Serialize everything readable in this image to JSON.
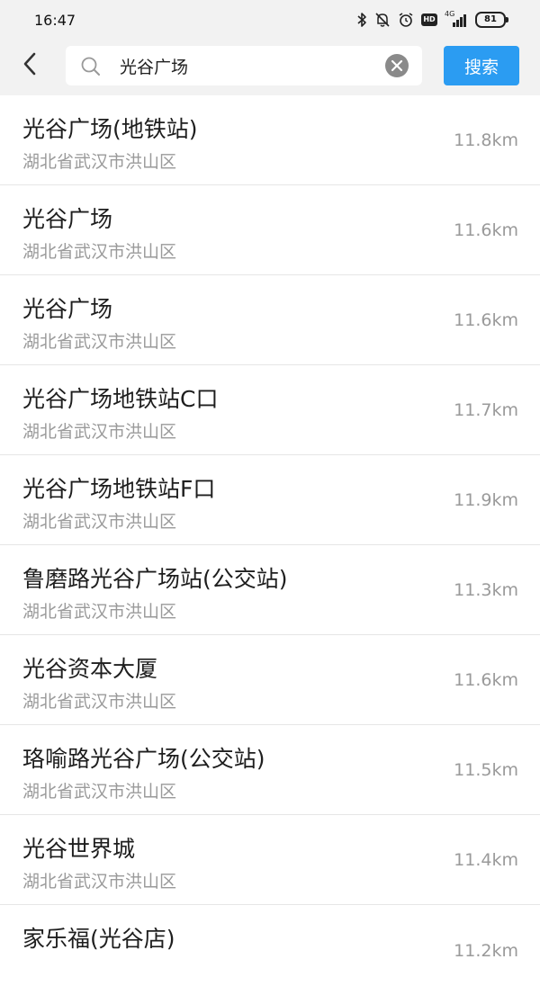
{
  "status_bar": {
    "time": "16:47",
    "network_label": "4G",
    "battery_level": "81",
    "hd_label": "HD",
    "icons": [
      "bluetooth-icon",
      "mute-icon",
      "alarm-icon",
      "hd-icon",
      "signal-icon",
      "battery-icon"
    ]
  },
  "header": {
    "back_icon": "chevron-left-icon",
    "search": {
      "value": "光谷广场",
      "icon": "search-icon",
      "clear_icon": "clear-icon"
    },
    "search_button_label": "搜索",
    "accent_color": "#2b9cf2"
  },
  "results": [
    {
      "name": "光谷广场(地铁站)",
      "address": "湖北省武汉市洪山区",
      "distance": "11.8km"
    },
    {
      "name": "光谷广场",
      "address": "湖北省武汉市洪山区",
      "distance": "11.6km"
    },
    {
      "name": "光谷广场",
      "address": "湖北省武汉市洪山区",
      "distance": "11.6km"
    },
    {
      "name": "光谷广场地铁站C口",
      "address": "湖北省武汉市洪山区",
      "distance": "11.7km"
    },
    {
      "name": "光谷广场地铁站F口",
      "address": "湖北省武汉市洪山区",
      "distance": "11.9km"
    },
    {
      "name": "鲁磨路光谷广场站(公交站)",
      "address": "湖北省武汉市洪山区",
      "distance": "11.3km"
    },
    {
      "name": "光谷资本大厦",
      "address": "湖北省武汉市洪山区",
      "distance": "11.6km"
    },
    {
      "name": "珞喻路光谷广场(公交站)",
      "address": "湖北省武汉市洪山区",
      "distance": "11.5km"
    },
    {
      "name": "光谷世界城",
      "address": "湖北省武汉市洪山区",
      "distance": "11.4km"
    },
    {
      "name": "家乐福(光谷店)",
      "address": "",
      "distance": "11.2km"
    }
  ]
}
